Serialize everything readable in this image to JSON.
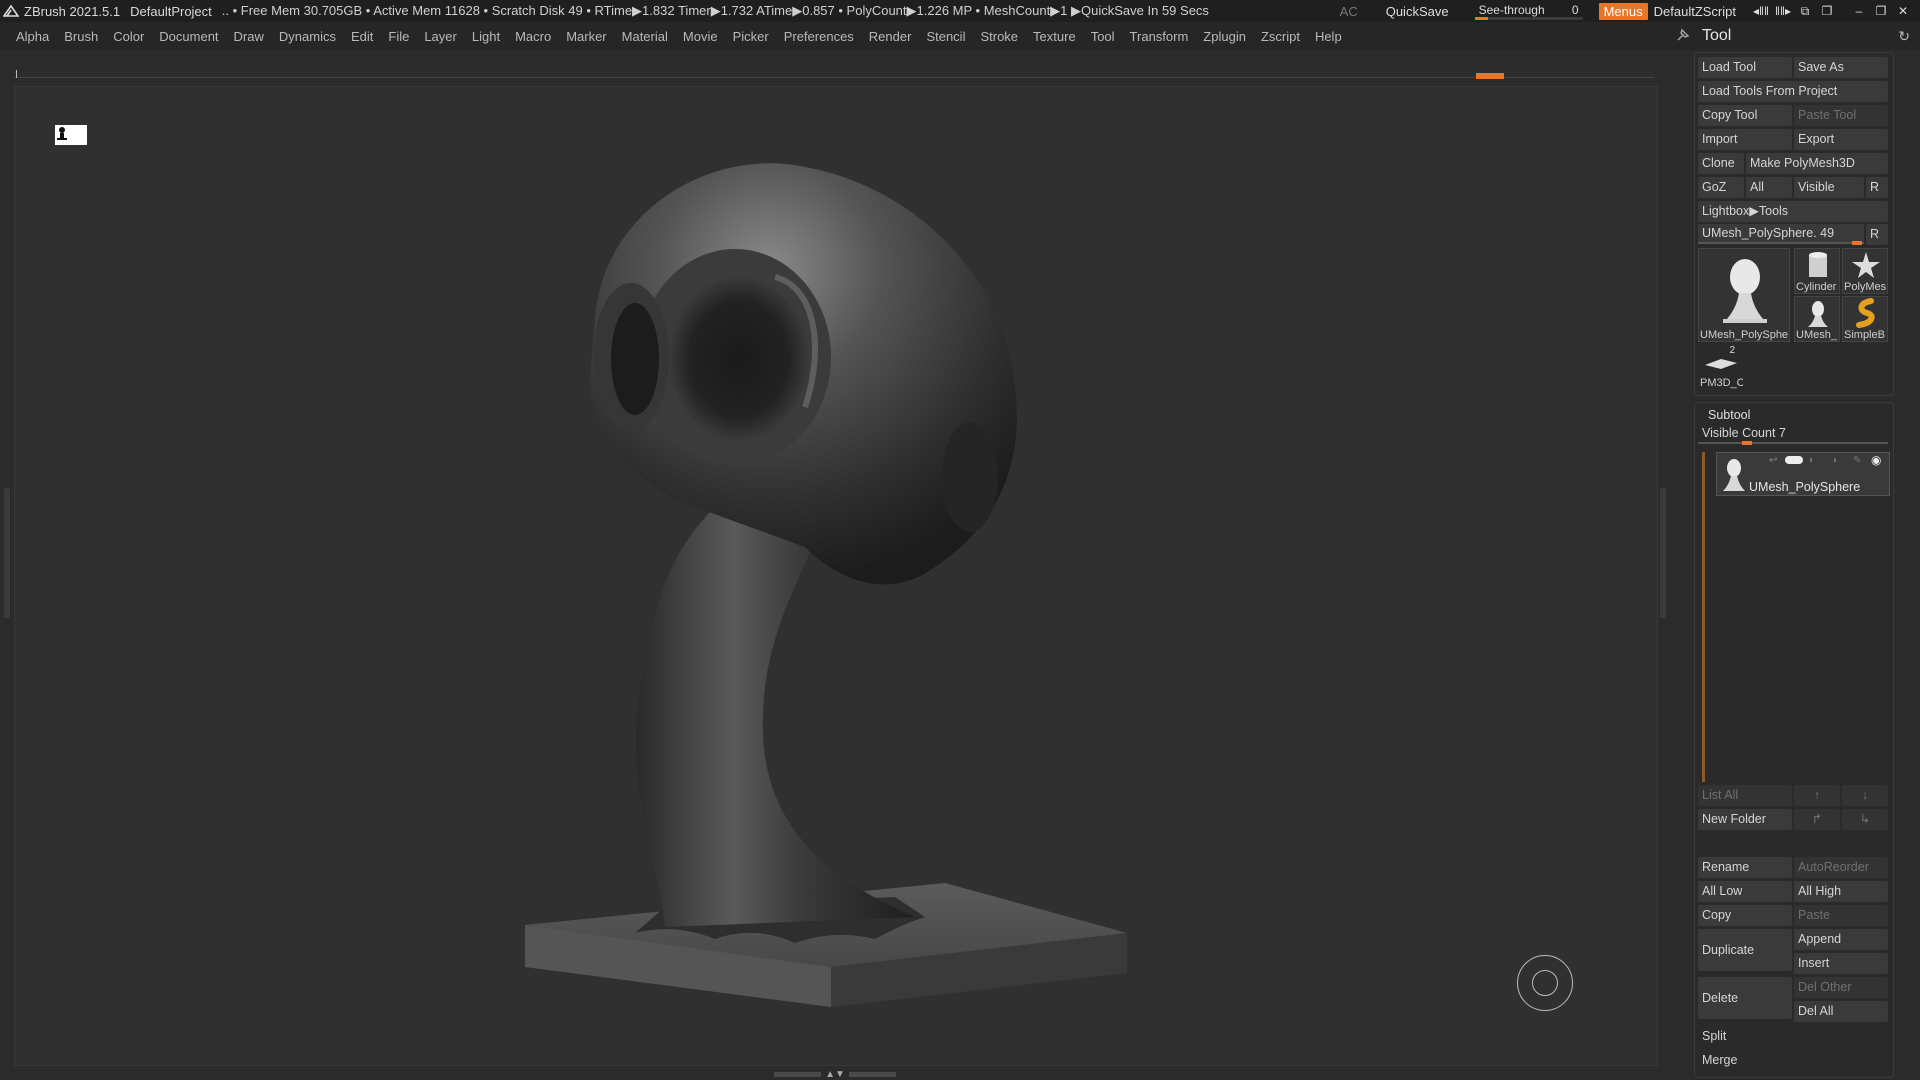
{
  "titlebar": {
    "app": "ZBrush 2021.5.1",
    "project": "DefaultProject",
    "status": ".. • Free Mem 30.705GB • Active Mem 11628 • Scratch Disk 49 • RTime▶1.832 Timer▶1.732 ATime▶0.857 • PolyCount▶1.226 MP • MeshCount▶1 ▶QuickSave In 59 Secs",
    "ac": "AC",
    "quicksave": "QuickSave",
    "seethrough_label": "See-through",
    "seethrough_value": "0",
    "menus": "Menus",
    "script": "DefaultZScript"
  },
  "menubar": {
    "items": [
      "Alpha",
      "Brush",
      "Color",
      "Document",
      "Draw",
      "Dynamics",
      "Edit",
      "File",
      "Layer",
      "Light",
      "Macro",
      "Marker",
      "Material",
      "Movie",
      "Picker",
      "Preferences",
      "Render",
      "Stencil",
      "Stroke",
      "Texture",
      "Tool",
      "Transform",
      "Zplugin",
      "Zscript",
      "Help"
    ]
  },
  "tool_palette": {
    "title": "Tool",
    "load_tool": "Load Tool",
    "save_as": "Save As",
    "load_tools_from_project": "Load Tools From Project",
    "copy_tool": "Copy Tool",
    "paste_tool": "Paste Tool",
    "import": "Import",
    "export": "Export",
    "clone": "Clone",
    "make_polymesh3d": "Make PolyMesh3D",
    "goz": "GoZ",
    "all": "All",
    "visible": "Visible",
    "r": "R",
    "lightbox_tools": "Lightbox▶Tools",
    "current_tool": "UMesh_PolySphere. 49",
    "thumbnails": {
      "main": "UMesh_PolySphe",
      "cylinder": "Cylinder",
      "polymesh": "PolyMes",
      "umesh_small": "UMesh_",
      "simpleb": "SimpleB",
      "pm3d": "PM3D_C",
      "pm3d_badge": "2"
    }
  },
  "subtool": {
    "title": "Subtool",
    "visible_count": "Visible Count 7",
    "item_name": "UMesh_PolySphere",
    "list_all": "List All",
    "new_folder": "New Folder",
    "rename": "Rename",
    "autoreorder": "AutoReorder",
    "all_low": "All Low",
    "all_high": "All High",
    "copy": "Copy",
    "paste": "Paste",
    "duplicate": "Duplicate",
    "append": "Append",
    "insert": "Insert",
    "del_other": "Del Other",
    "delete": "Delete",
    "del_all": "Del All",
    "split": "Split",
    "merge": "Merge"
  },
  "colors": {
    "accent": "#e5762a",
    "panel_bg": "#262626",
    "canvas_bg": "#303030"
  }
}
